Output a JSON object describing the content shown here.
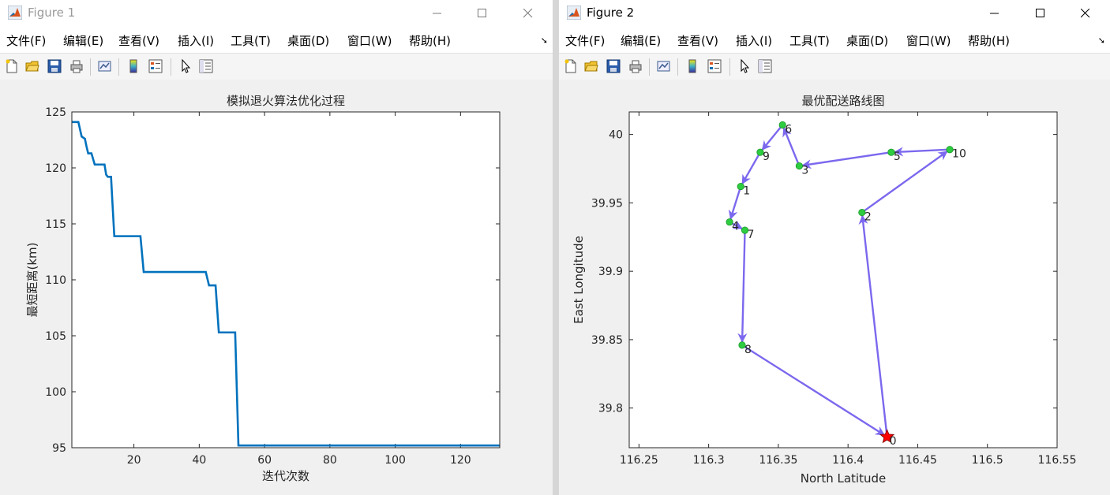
{
  "menu_labels": [
    "文件(F)",
    "编辑(E)",
    "查看(V)",
    "插入(I)",
    "工具(T)",
    "桌面(D)",
    "窗口(W)",
    "帮助(H)"
  ],
  "window1": {
    "title": "Figure 1",
    "chart_data": {
      "type": "line",
      "title": "模拟退火算法优化过程",
      "xlabel": "迭代次数",
      "ylabel": "最短距离(km)",
      "xlim": [
        1,
        132
      ],
      "ylim": [
        95,
        125
      ],
      "xticks": [
        20,
        40,
        60,
        80,
        100,
        120
      ],
      "yticks": [
        95,
        100,
        105,
        110,
        115,
        120,
        125
      ],
      "series": [
        {
          "color": "#0072BD",
          "x": [
            1,
            3,
            4,
            5,
            5.5,
            6,
            7,
            8,
            9,
            11,
            11.5,
            12,
            13,
            13.5,
            14,
            22,
            23,
            42,
            43,
            45,
            46,
            51,
            52,
            132
          ],
          "y": [
            124.1,
            124.1,
            122.8,
            122.6,
            121.9,
            121.3,
            121.3,
            120.3,
            120.3,
            120.3,
            119.4,
            119.2,
            119.2,
            116.5,
            113.9,
            113.9,
            110.7,
            110.7,
            109.5,
            109.5,
            105.3,
            105.3,
            95.2,
            95.2
          ]
        }
      ]
    }
  },
  "window2": {
    "title": "Figure 2",
    "chart_data": {
      "type": "scatter",
      "title": "最优配送路线图",
      "xlabel": "North Latitude",
      "ylabel": "East Longitude",
      "xlim": [
        116.243,
        116.55
      ],
      "ylim": [
        39.771,
        40.0165
      ],
      "xticks": [
        116.25,
        116.3,
        116.35,
        116.4,
        116.45,
        116.5,
        116.55
      ],
      "yticks": [
        39.8,
        39.85,
        39.9,
        39.95,
        40
      ],
      "tick_labels_x": [
        "116.25",
        "116.3",
        "116.35",
        "116.4",
        "116.45",
        "116.5",
        "116.55"
      ],
      "tick_labels_y": [
        "39.8",
        "39.85",
        "39.9",
        "39.95",
        "40"
      ],
      "route_color": "#7B68EE",
      "point_color": "#2ECC40",
      "depot_color": "#FF0000",
      "points": [
        {
          "label": "0",
          "x": 116.428,
          "y": 39.779
        },
        {
          "label": "1",
          "x": 116.323,
          "y": 39.962
        },
        {
          "label": "2",
          "x": 116.41,
          "y": 39.943
        },
        {
          "label": "3",
          "x": 116.365,
          "y": 39.977
        },
        {
          "label": "4",
          "x": 116.315,
          "y": 39.936
        },
        {
          "label": "5",
          "x": 116.431,
          "y": 39.987
        },
        {
          "label": "6",
          "x": 116.353,
          "y": 40.007
        },
        {
          "label": "7",
          "x": 116.326,
          "y": 39.93
        },
        {
          "label": "8",
          "x": 116.324,
          "y": 39.846
        },
        {
          "label": "9",
          "x": 116.337,
          "y": 39.987
        },
        {
          "label": "10",
          "x": 116.473,
          "y": 39.989
        }
      ],
      "route_order": [
        "0",
        "2",
        "10",
        "5",
        "3",
        "6",
        "9",
        "1",
        "4",
        "7",
        "8",
        "0"
      ]
    }
  }
}
